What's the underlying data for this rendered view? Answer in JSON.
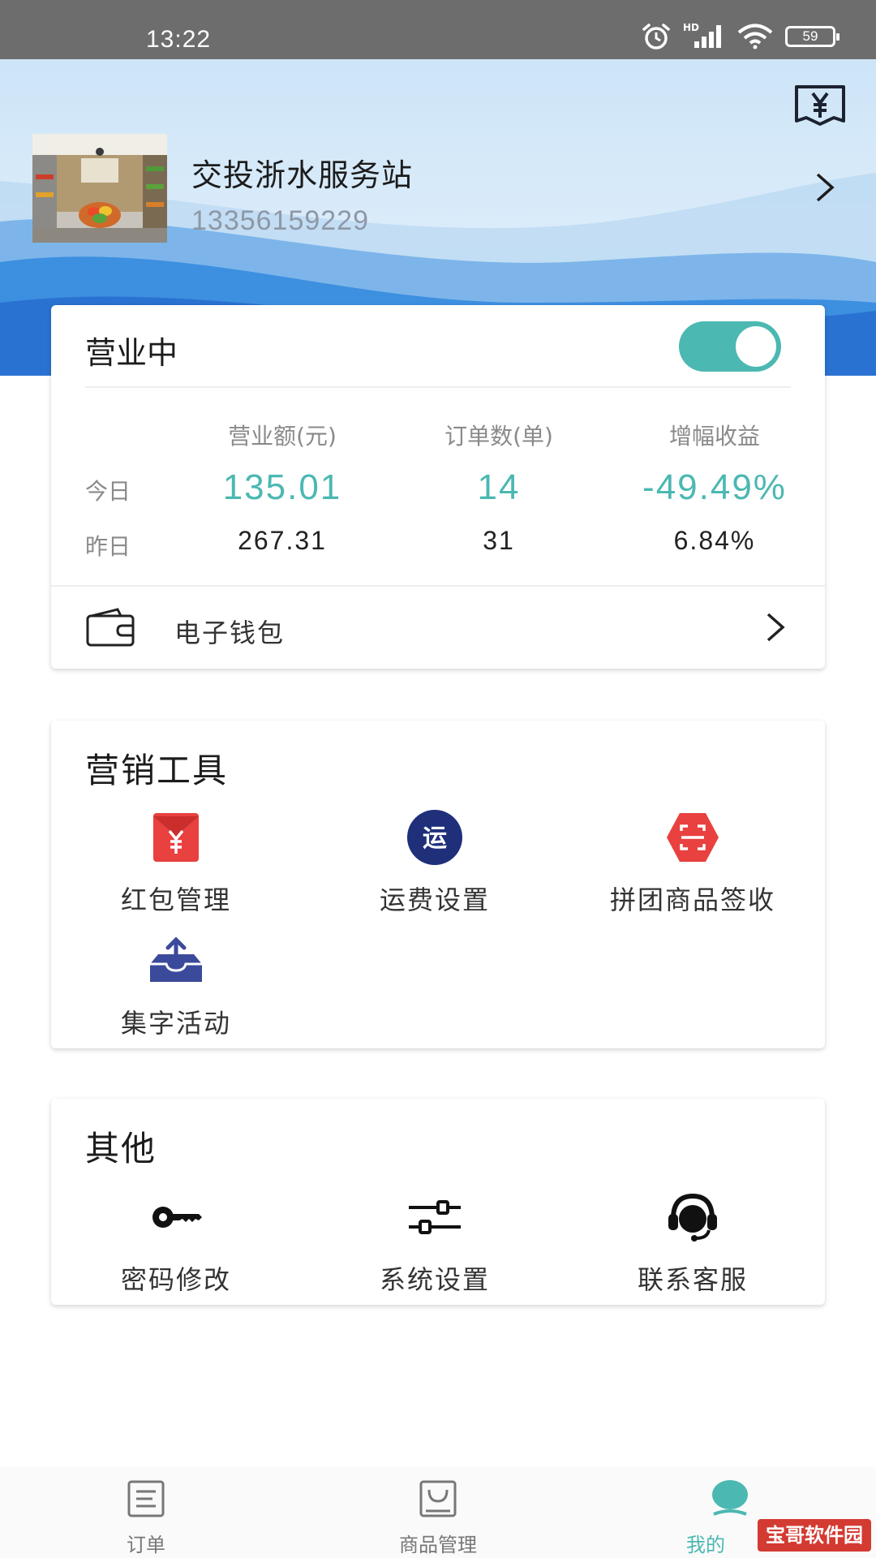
{
  "status_bar": {
    "time": "13:22",
    "battery": "59",
    "hd": "HD"
  },
  "header": {
    "store_name": "交投浙水服务站",
    "phone": "13356159229"
  },
  "business": {
    "status_label": "营业中",
    "toggle_on": true,
    "columns": [
      "营业额(元)",
      "订单数(单)",
      "增幅收益"
    ],
    "rows": [
      {
        "label": "今日",
        "values": [
          "135.01",
          "14",
          "-49.49%"
        ]
      },
      {
        "label": "昨日",
        "values": [
          "267.31",
          "31",
          "6.84%"
        ]
      }
    ],
    "wallet_label": "电子钱包"
  },
  "marketing": {
    "title": "营销工具",
    "tools": [
      {
        "label": "红包管理",
        "icon": "red-envelope-icon"
      },
      {
        "label": "运费设置",
        "icon": "shipping-icon",
        "icon_text": "运"
      },
      {
        "label": "拼团商品签收",
        "icon": "scan-icon"
      },
      {
        "label": "集字活动",
        "icon": "upload-tray-icon"
      }
    ]
  },
  "other": {
    "title": "其他",
    "items": [
      {
        "label": "密码修改",
        "icon": "key-icon"
      },
      {
        "label": "系统设置",
        "icon": "sliders-icon"
      },
      {
        "label": "联系客服",
        "icon": "headset-icon"
      }
    ]
  },
  "bottom_nav": {
    "items": [
      {
        "label": "订单",
        "icon": "order-list-icon"
      },
      {
        "label": "商品管理",
        "icon": "bag-icon"
      },
      {
        "label": "我的",
        "icon": "profile-icon",
        "active": true
      }
    ]
  },
  "watermark": "宝哥软件园",
  "colors": {
    "accent": "#4bb8b2",
    "red": "#e8413f",
    "navy": "#1f2f7a"
  }
}
